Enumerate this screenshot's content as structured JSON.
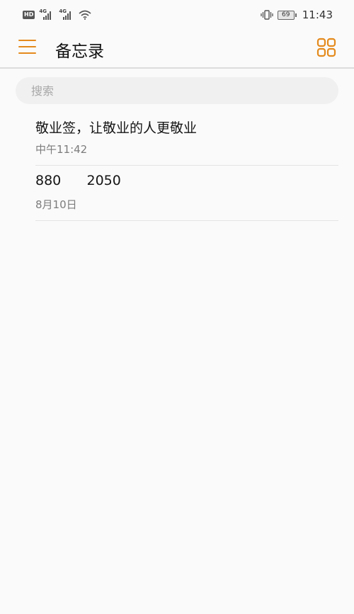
{
  "status_bar": {
    "hd": "HD",
    "network_1": "4G",
    "network_2": "4G",
    "battery_level": "69",
    "time": "11:43"
  },
  "app_bar": {
    "menu_icon": "menu-icon",
    "title": "备忘录",
    "grid_icon": "grid-view-icon",
    "accent_color": "#e48a1c"
  },
  "search": {
    "placeholder": "搜索",
    "value": ""
  },
  "notes": [
    {
      "title": "敬业签，让敬业的人更敬业",
      "date": "中午11:42"
    },
    {
      "title": "880      2050",
      "date": "8月10日"
    }
  ]
}
